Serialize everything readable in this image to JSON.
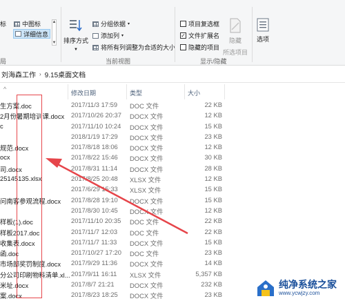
{
  "ribbon": {
    "layout": {
      "list_label": "标",
      "medium_icons": "中图标",
      "details": "详细信息",
      "group_partial": "局"
    },
    "current_view": {
      "sort_by": "排序方式",
      "group_by": "分组依据",
      "add_columns": "添加列",
      "size_all_columns": "将所有列调整为合适的大小",
      "group_label": "当前视图"
    },
    "show_hide": {
      "item_checkboxes": "项目复选框",
      "file_extensions": "文件扩展名",
      "hidden_items": "隐藏的项目",
      "hide_selected": "隐藏",
      "hide_selected_2": "所选项目",
      "group_label": "显示/隐藏"
    },
    "options": "选项"
  },
  "address": {
    "parts": [
      "刘海森工作",
      "9.15桌面文档"
    ]
  },
  "columns": {
    "date": "修改日期",
    "type": "类型",
    "size": "大小"
  },
  "files": [
    {
      "name": "生方案.doc",
      "date": "2017/11/3 17:59",
      "type": "DOC 文件",
      "size": "22 KB"
    },
    {
      "name": "2月份暑期培训课.docx",
      "date": "2017/10/26 20:37",
      "type": "DOCX 文件",
      "size": "12 KB"
    },
    {
      "name": "c",
      "date": "2017/11/10 10:24",
      "type": "DOCX 文件",
      "size": "15 KB"
    },
    {
      "name": "",
      "date": "2018/1/19 17:29",
      "type": "DOCX 文件",
      "size": "23 KB"
    },
    {
      "name": "规范.docx",
      "date": "2017/8/18 18:06",
      "type": "DOCX 文件",
      "size": "12 KB"
    },
    {
      "name": "ocx",
      "date": "2017/8/22 15:46",
      "type": "DOCX 文件",
      "size": "30 KB"
    },
    {
      "name": "司.docx",
      "date": "2017/8/31 11:14",
      "type": "DOCX 文件",
      "size": "28 KB"
    },
    {
      "name": "25145135.xlsx",
      "date": "2017/8/25 20:48",
      "type": "XLSX 文件",
      "size": "12 KB"
    },
    {
      "name": "",
      "date": "2017/6/29 15:33",
      "type": "XLSX 文件",
      "size": "15 KB"
    },
    {
      "name": "问南客参观流程.docx",
      "date": "2017/8/28 19:10",
      "type": "DOCX 文件",
      "size": "15 KB"
    },
    {
      "name": "",
      "date": "2017/8/30 10:45",
      "type": "DOCX 文件",
      "size": "12 KB"
    },
    {
      "name": "样板(1).doc",
      "date": "2017/11/10 20:35",
      "type": "DOC 文件",
      "size": "22 KB"
    },
    {
      "name": "样板2017.doc",
      "date": "2017/11/7 12:03",
      "type": "DOC 文件",
      "size": "22 KB"
    },
    {
      "name": "收集表.docx",
      "date": "2017/11/7 11:33",
      "type": "DOCX 文件",
      "size": "15 KB"
    },
    {
      "name": "函.doc",
      "date": "2017/10/27 17:20",
      "type": "DOC 文件",
      "size": "23 KB"
    },
    {
      "name": "市场部奖罚制度.docx",
      "date": "2017/9/29 11:36",
      "type": "DOCX 文件",
      "size": "14 KB"
    },
    {
      "name": "分公司印刷物料清单.xl...",
      "date": "2017/9/11 16:11",
      "type": "XLSX 文件",
      "size": "5,357 KB"
    },
    {
      "name": "米址.docx",
      "date": "2017/8/7 21:21",
      "type": "DOCX 文件",
      "size": "232 KB"
    },
    {
      "name": "案.docx",
      "date": "2017/8/23 18:25",
      "type": "DOCX 文件",
      "size": "23 KB"
    }
  ],
  "watermark": {
    "title": "纯净系统之家",
    "url": "www.ycwjzy.com"
  },
  "colors": {
    "annotation": "#e6454a",
    "selection": "#cce4f7",
    "header_text": "#4c607a"
  }
}
